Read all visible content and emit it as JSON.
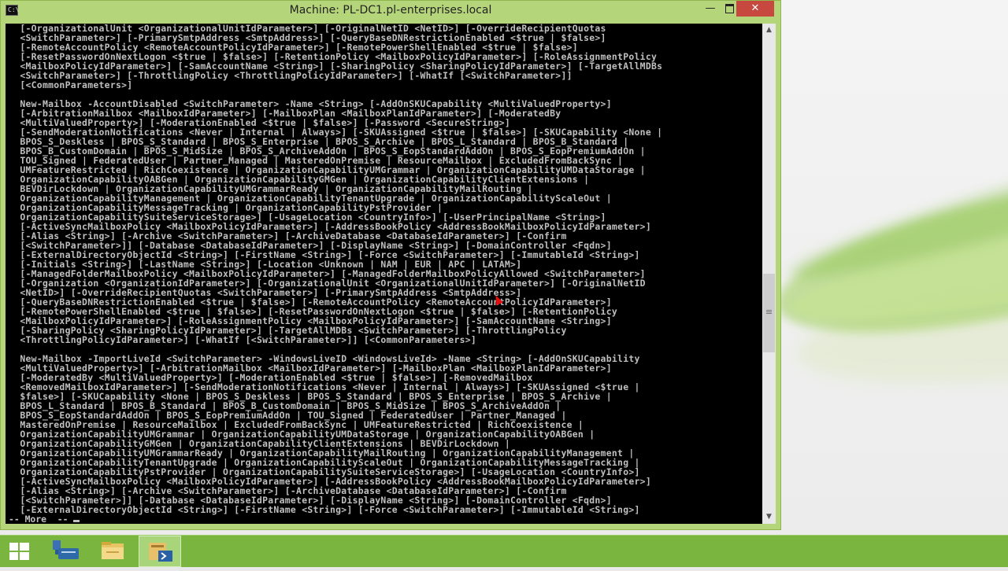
{
  "window": {
    "title": "Machine: PL-DC1.pl-enterprises.local",
    "minimize_label": "—",
    "close_label": "✕"
  },
  "console": {
    "lines": [
      "  [-OrganizationalUnit <OrganizationalUnitIdParameter>] [-OriginalNetID <NetID>] [-OverrideRecipientQuotas",
      "  <SwitchParameter>] [-PrimarySmtpAddress <SmtpAddress>] [-QueryBaseDNRestrictionEnabled <$true | $false>]",
      "  [-RemoteAccountPolicy <RemoteAccountPolicyIdParameter>] [-RemotePowerShellEnabled <$true | $false>]",
      "  [-ResetPasswordOnNextLogon <$true | $false>] [-RetentionPolicy <MailboxPolicyIdParameter>] [-RoleAssignmentPolicy",
      "  <MailboxPolicyIdParameter>] [-SamAccountName <String>] [-SharingPolicy <SharingPolicyIdParameter>] [-TargetAllMDBs",
      "  <SwitchParameter>] [-ThrottlingPolicy <ThrottlingPolicyIdParameter>] [-WhatIf [<SwitchParameter>]]",
      "  [<CommonParameters>]",
      "",
      "  New-Mailbox -AccountDisabled <SwitchParameter> -Name <String> [-AddOnSKUCapability <MultiValuedProperty>]",
      "  [-ArbitrationMailbox <MailboxIdParameter>] [-MailboxPlan <MailboxPlanIdParameter>] [-ModeratedBy",
      "  <MultiValuedProperty>] [-ModerationEnabled <$true | $false>] [-Password <SecureString>]",
      "  [-SendModerationNotifications <Never | Internal | Always>] [-SKUAssigned <$true | $false>] [-SKUCapability <None |",
      "  BPOS_S_Deskless | BPOS_S_Standard | BPOS_S_Enterprise | BPOS_S_Archive | BPOS_L_Standard | BPOS_B_Standard |",
      "  BPOS_B_CustomDomain | BPOS_S_MidSize | BPOS_S_ArchiveAddOn | BPOS_S_EopStandardAddOn | BPOS_S_EopPremiumAddOn |",
      "  TOU_Signed | FederatedUser | Partner_Managed | MasteredOnPremise | ResourceMailbox | ExcludedFromBackSync |",
      "  UMFeatureRestricted | RichCoexistence | OrganizationCapabilityUMGrammar | OrganizationCapabilityUMDataStorage |",
      "  OrganizationCapabilityOABGen | OrganizationCapabilityGMGen | OrganizationCapabilityClientExtensions |",
      "  BEVDirLockdown | OrganizationCapabilityUMGrammarReady | OrganizationCapabilityMailRouting |",
      "  OrganizationCapabilityManagement | OrganizationCapabilityTenantUpgrade | OrganizationCapabilityScaleOut |",
      "  OrganizationCapabilityMessageTracking | OrganizationCapabilityPstProvider |",
      "  OrganizationCapabilitySuiteServiceStorage>] [-UsageLocation <CountryInfo>] [-UserPrincipalName <String>]",
      "  [-ActiveSyncMailboxPolicy <MailboxPolicyIdParameter>] [-AddressBookPolicy <AddressBookMailboxPolicyIdParameter>]",
      "  [-Alias <String>] [-Archive <SwitchParameter>] [-ArchiveDatabase <DatabaseIdParameter>] [-Confirm",
      "  [<SwitchParameter>]] [-Database <DatabaseIdParameter>] [-DisplayName <String>] [-DomainController <Fqdn>]",
      "  [-ExternalDirectoryObjectId <String>] [-FirstName <String>] [-Force <SwitchParameter>] [-ImmutableId <String>]",
      "  [-Initials <String>] [-LastName <String>] [-Location <Unknown | NAM | EUR | APC | LATAM>]",
      "  [-ManagedFolderMailboxPolicy <MailboxPolicyIdParameter>] [-ManagedFolderMailboxPolicyAllowed <SwitchParameter>]",
      "  [-Organization <OrganizationIdParameter>] [-OrganizationalUnit <OrganizationalUnitIdParameter>] [-OriginalNetID",
      "  <NetID>] [-OverrideRecipientQuotas <SwitchParameter>] [-PrimarySmtpAddress <SmtpAddress>]",
      "  [-QueryBaseDNRestrictionEnabled <$true | $false>] [-RemoteAccountPolicy <RemoteAccountPolicyIdParameter>]",
      "  [-RemotePowerShellEnabled <$true | $false>] [-ResetPasswordOnNextLogon <$true | $false>] [-RetentionPolicy",
      "  <MailboxPolicyIdParameter>] [-RoleAssignmentPolicy <MailboxPolicyIdParameter>] [-SamAccountName <String>]",
      "  [-SharingPolicy <SharingPolicyIdParameter>] [-TargetAllMDBs <SwitchParameter>] [-ThrottlingPolicy",
      "  <ThrottlingPolicyIdParameter>] [-WhatIf [<SwitchParameter>]] [<CommonParameters>]",
      "",
      "  New-Mailbox -ImportLiveId <SwitchParameter> -WindowsLiveID <WindowsLiveId> -Name <String> [-AddOnSKUCapability",
      "  <MultiValuedProperty>] [-ArbitrationMailbox <MailboxIdParameter>] [-MailboxPlan <MailboxPlanIdParameter>]",
      "  [-ModeratedBy <MultiValuedProperty>] [-ModerationEnabled <$true | $false>] [-RemovedMailbox",
      "  <RemovedMailboxIdParameter>] [-SendModerationNotifications <Never | Internal | Always>] [-SKUAssigned <$true |",
      "  $false>] [-SKUCapability <None | BPOS_S_Deskless | BPOS_S_Standard | BPOS_S_Enterprise | BPOS_S_Archive |",
      "  BPOS_L_Standard | BPOS_B_Standard | BPOS_B_CustomDomain | BPOS_S_MidSize | BPOS_S_ArchiveAddOn |",
      "  BPOS_S_EopStandardAddOn | BPOS_S_EopPremiumAddOn | TOU_Signed | FederatedUser | Partner_Managed |",
      "  MasteredOnPremise | ResourceMailbox | ExcludedFromBackSync | UMFeatureRestricted | RichCoexistence |",
      "  OrganizationCapabilityUMGrammar | OrganizationCapabilityUMDataStorage | OrganizationCapabilityOABGen |",
      "  OrganizationCapabilityGMGen | OrganizationCapabilityClientExtensions | BEVDirLockdown |",
      "  OrganizationCapabilityUMGrammarReady | OrganizationCapabilityMailRouting | OrganizationCapabilityManagement |",
      "  OrganizationCapabilityTenantUpgrade | OrganizationCapabilityScaleOut | OrganizationCapabilityMessageTracking |",
      "  OrganizationCapabilityPstProvider | OrganizationCapabilitySuiteServiceStorage>] [-UsageLocation <CountryInfo>]",
      "  [-ActiveSyncMailboxPolicy <MailboxPolicyIdParameter>] [-AddressBookPolicy <AddressBookMailboxPolicyIdParameter>]",
      "  [-Alias <String>] [-Archive <SwitchParameter>] [-ArchiveDatabase <DatabaseIdParameter>] [-Confirm",
      "  [<SwitchParameter>]] [-Database <DatabaseIdParameter>] [-DisplayName <String>] [-DomainController <Fqdn>]",
      "  [-ExternalDirectoryObjectId <String>] [-FirstName <String>] [-Force <SwitchParameter>] [-ImmutableId <String>]"
    ],
    "more_prompt": "-- More  --"
  },
  "scrollbar": {
    "position_fraction": 0.6
  },
  "taskbar": {
    "items": [
      {
        "name": "start",
        "icon": "windows-logo-icon"
      },
      {
        "name": "server-manager",
        "icon": "server-manager-icon"
      },
      {
        "name": "file-explorer",
        "icon": "folder-icon"
      },
      {
        "name": "powershell",
        "icon": "powershell-icon",
        "active": true
      }
    ]
  },
  "colors": {
    "console_bg": "#000000",
    "console_fg": "#c0c0c0",
    "window_frame": "#b5d57a",
    "taskbar": "#7ab540",
    "close_button": "#c7483f"
  }
}
